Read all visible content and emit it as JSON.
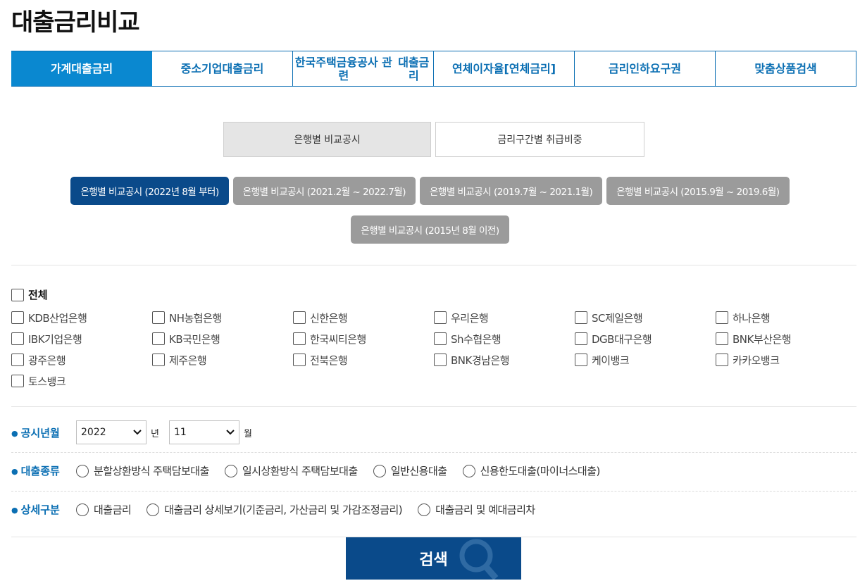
{
  "page": {
    "title": "대출금리비교"
  },
  "main_tabs": [
    {
      "label": "가계대출금리"
    },
    {
      "label": "중소기업대출금리"
    },
    {
      "label_line1": "한국주택금융공사 관련",
      "label_line2": "대출금리"
    },
    {
      "label": "연체이자율[연체금리]"
    },
    {
      "label": "금리인하요구권"
    },
    {
      "label": "맞춤상품검색"
    }
  ],
  "sub_tabs": [
    {
      "label": "은행별 비교공시"
    },
    {
      "label": "금리구간별 취급비중"
    }
  ],
  "periods": [
    {
      "label": "은행별 비교공시 (2022년 8월 부터)"
    },
    {
      "label": "은행별 비교공시 (2021.2월 ~ 2022.7월)"
    },
    {
      "label": "은행별 비교공시 (2019.7월 ~ 2021.1월)"
    },
    {
      "label": "은행별 비교공시 (2015.9월 ~ 2019.6월)"
    },
    {
      "label": "은행별 비교공시 (2015년 8월 이전)"
    }
  ],
  "banks": {
    "all_label": "전체",
    "items": [
      "KDB산업은행",
      "NH농협은행",
      "신한은행",
      "우리은행",
      "SC제일은행",
      "하나은행",
      "IBK기업은행",
      "KB국민은행",
      "한국씨티은행",
      "Sh수협은행",
      "DGB대구은행",
      "BNK부산은행",
      "광주은행",
      "제주은행",
      "전북은행",
      "BNK경남은행",
      "케이뱅크",
      "카카오뱅크",
      "토스뱅크"
    ]
  },
  "form": {
    "date": {
      "label": "공시년월",
      "year": "2022",
      "year_unit": "년",
      "month": "11",
      "month_unit": "월"
    },
    "loan_type": {
      "label": "대출종류",
      "options": [
        "분할상환방식 주택담보대출",
        "일시상환방식 주택담보대출",
        "일반신용대출",
        "신용한도대출(마이너스대출)"
      ]
    },
    "detail": {
      "label": "상세구분",
      "options": [
        "대출금리",
        "대출금리 상세보기(기준금리, 가산금리 및 가감조정금리)",
        "대출금리 및 예대금리차"
      ]
    }
  },
  "search": {
    "label": "검색"
  },
  "colors": {
    "brand_blue": "#0a88d0",
    "navy": "#0a4a8a",
    "inactive_gray": "#9b9b9b"
  }
}
